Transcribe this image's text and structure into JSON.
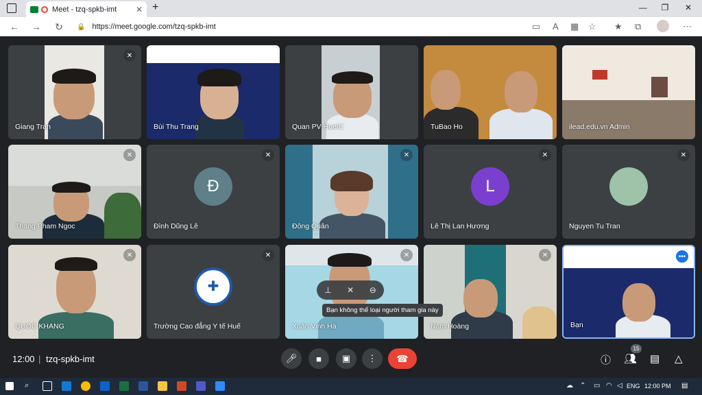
{
  "browser": {
    "tab_title": "Meet - tzq-spkb-imt",
    "url": "https://meet.google.com/tzq-spkb-imt"
  },
  "tiles": [
    {
      "name": "Giang Tran"
    },
    {
      "name": "Bùi Thu Trang"
    },
    {
      "name": "Quan PV HueIC"
    },
    {
      "name": "TuBao Ho"
    },
    {
      "name": "ilead.edu.vn Admin"
    },
    {
      "name": "Thang Pham Ngoc"
    },
    {
      "name": "Đình Dũng Lê",
      "initial": "Đ",
      "color": "#5f7f89"
    },
    {
      "name": "Đông Quân"
    },
    {
      "name": "Lê Thị Lan Hương",
      "initial": "L",
      "color": "#7b3fd0"
    },
    {
      "name": "Nguyen Tu Tran"
    },
    {
      "name": "QUOC KHANG"
    },
    {
      "name": "Trường Cao đẳng Y tế Huế"
    },
    {
      "name": "Xuân Vinh Hà"
    },
    {
      "name": "Nam Hoàng"
    },
    {
      "name": "Bạn"
    }
  ],
  "tooltip": "Bạn không thể loại người tham gia này",
  "bottom": {
    "time": "12:00",
    "separator": "|",
    "meeting_code": "tzq-spkb-imt",
    "participant_count": "15"
  },
  "taskbar": {
    "language": "ENG",
    "clock": "12:00 PM"
  },
  "colors": {
    "accent": "#8ab4f8",
    "hangup": "#ea4335",
    "background": "#202124"
  }
}
